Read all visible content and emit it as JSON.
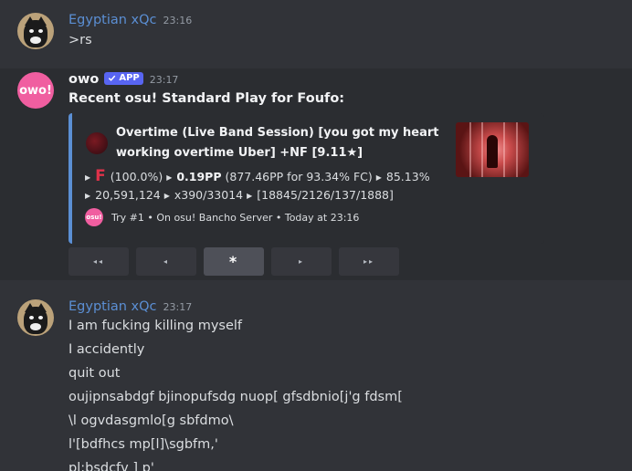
{
  "messages": [
    {
      "author": "Egyptian xQc",
      "time": "23:16",
      "lines": [
        ">rs"
      ]
    },
    {
      "author": "owo",
      "badge": "APP",
      "avatar_text": "owo!",
      "time": "23:17",
      "text": "Recent osu! Standard Play for Foufo:",
      "embed": {
        "title": "Overtime (Live Band Session) [you got my heart working overtime Uber] +NF [9.11★]",
        "line1": {
          "grade": "F",
          "accuracy": "(100.0%)",
          "pp": "0.19PP",
          "fc_info": "(877.46PP for 93.34% FC)",
          "percent": "85.13%"
        },
        "line2": {
          "score": "20,591,124",
          "combo": "x390/33014",
          "hits": "[18845/2126/137/1888]"
        },
        "footer": {
          "icon_text": "osu!",
          "text": "Try #1 • On osu! Bancho Server • Today at 23:16"
        },
        "accent_color": "#5b8fd4"
      },
      "buttons": [
        "◂◂",
        "◂",
        "*",
        "▸",
        "▸▸"
      ]
    },
    {
      "author": "Egyptian xQc",
      "time": "23:17",
      "lines": [
        "I am fucking killing myself",
        "I accidently",
        "quit out",
        "oujipnsabdgf bjinopufsdg nuop[ gfsdbnio[j'g fdsm[",
        "\\l ogvdasgmlo[g sbfdmo\\",
        "l'[bdfhcs mp[l]\\sgbfm,'",
        "pl;bsdcfv ] p'"
      ]
    }
  ],
  "colors": {
    "background": "#313338",
    "author_blue": "#5b8fd4",
    "app_badge": "#5865f2",
    "owo_pink": "#f05ea0",
    "grade_f": "#e0324a"
  },
  "icons": [
    "cat-avatar",
    "owo-avatar",
    "verified-check-icon",
    "osu-logo-icon",
    "triangle-bullet-icon"
  ]
}
